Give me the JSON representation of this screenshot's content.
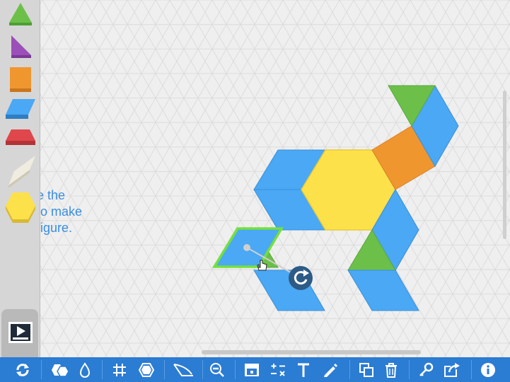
{
  "instructions": {
    "line1": "e the",
    "line2": "to make",
    "line3": "figure."
  },
  "palette": {
    "shapes": [
      "triangle",
      "right-triangle",
      "square",
      "rhombus",
      "trapezoid",
      "thin-rhombus",
      "hexagon"
    ],
    "colors": {
      "green": "#6cc04a",
      "purple": "#9b4fb8",
      "orange": "#f0962f",
      "blue": "#4aa8f5",
      "red": "#e0474c",
      "cream": "#f1ece0",
      "yellow": "#fde14a"
    }
  },
  "toolbar": {
    "tools": [
      "refresh-icon",
      "shapes-icon",
      "fill-icon",
      "grid-icon",
      "snap-icon",
      "angle-icon",
      "zoom-out-icon",
      "scene-icon",
      "math-icon",
      "text-icon",
      "pen-icon",
      "duplicate-icon",
      "trash-icon",
      "key-icon",
      "share-icon",
      "info-icon"
    ]
  },
  "colors": {
    "toolbar": "#2b7cd3",
    "selection": "#74e03a",
    "rotate_handle": "#2e5a86"
  }
}
